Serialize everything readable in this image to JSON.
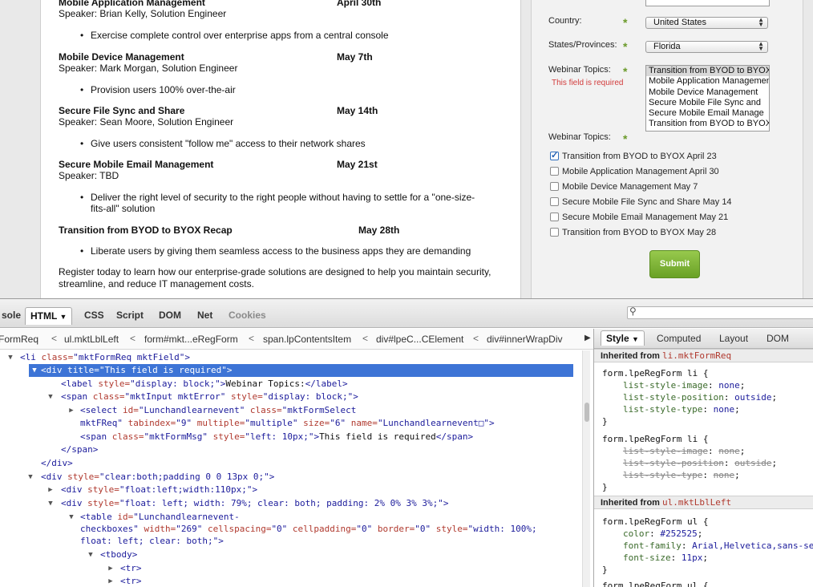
{
  "webpage": {
    "sessions": [
      {
        "title": "Mobile Application Management",
        "date": "April 30th",
        "speaker": "Speaker: Brian Kelly, Solution Engineer",
        "bullet": "Exercise complete control over enterprise apps from a central console"
      },
      {
        "title": "Mobile Device Management",
        "date": "May 7th",
        "speaker": "Speaker: Mark Morgan, Solution Engineer",
        "bullet": "Provision users 100% over-the-air"
      },
      {
        "title": "Secure File Sync and Share",
        "date": "May 14th",
        "speaker": "Speaker: Sean Moore, Solution Engineer",
        "bullet": "Give users consistent \"follow me\" access to their network shares"
      },
      {
        "title": "Secure Mobile Email Management",
        "date": "May 21st",
        "speaker": "Speaker: TBD",
        "bullet": "Deliver the right level of security to the right people without having to settle for a \"one-size-fits-all\" solution"
      },
      {
        "title": "Transition from BYOD to BYOX Recap",
        "date": "May 28th",
        "speaker": "",
        "bullet": "Liberate users by giving them seamless access to the business apps they are demanding"
      }
    ],
    "footer": "Register today to learn how our enterprise-grade solutions are designed to help you maintain security, streamline, and reduce IT management costs."
  },
  "form": {
    "country_label": "Country:",
    "country_value": "United States",
    "state_label": "States/Provinces:",
    "state_value": "Florida",
    "topics_label": "Webinar Topics:",
    "topics_error": "This field is required",
    "topics_options": [
      "Transition from BYOD to BYOX",
      "Mobile Application Management",
      "Mobile Device Management",
      "Secure Mobile File Sync and",
      "Secure Mobile Email Manage",
      "Transition from BYOD to BYOX"
    ],
    "topics_label_2": "Webinar Topics:",
    "checkboxes": [
      {
        "label": "Transition from BYOD to BYOX April 23",
        "checked": true
      },
      {
        "label": "Mobile Application Management April 30",
        "checked": false
      },
      {
        "label": "Mobile Device Management May 7",
        "checked": false
      },
      {
        "label": "Secure Mobile File Sync and Share May 14",
        "checked": false
      },
      {
        "label": "Secure Mobile Email Management May 21",
        "checked": false
      },
      {
        "label": "Transition from BYOD to BYOX May 28",
        "checked": false
      }
    ],
    "submit_label": "Submit",
    "required_star": "*"
  },
  "firebug": {
    "tabs": [
      "sole",
      "HTML",
      "CSS",
      "Script",
      "DOM",
      "Net",
      "Cookies"
    ],
    "breadcrumbs": [
      "FormReq",
      "ul.mktLblLeft",
      "form#mkt...eRegForm",
      "span.lpContentsItem",
      "div#lpeC...CElement",
      "div#innerWrapDiv"
    ],
    "side_tabs": [
      "Style",
      "Computed",
      "Layout",
      "DOM"
    ],
    "inherited_1": {
      "prefix": "Inherited from ",
      "ref": "li.mktFormReq"
    },
    "inherited_2": {
      "prefix": "Inherited from ",
      "ref": "ul.mktLblLeft"
    },
    "icons": {
      "search": "search-icon",
      "dropdown": "chevron-down-icon"
    }
  }
}
